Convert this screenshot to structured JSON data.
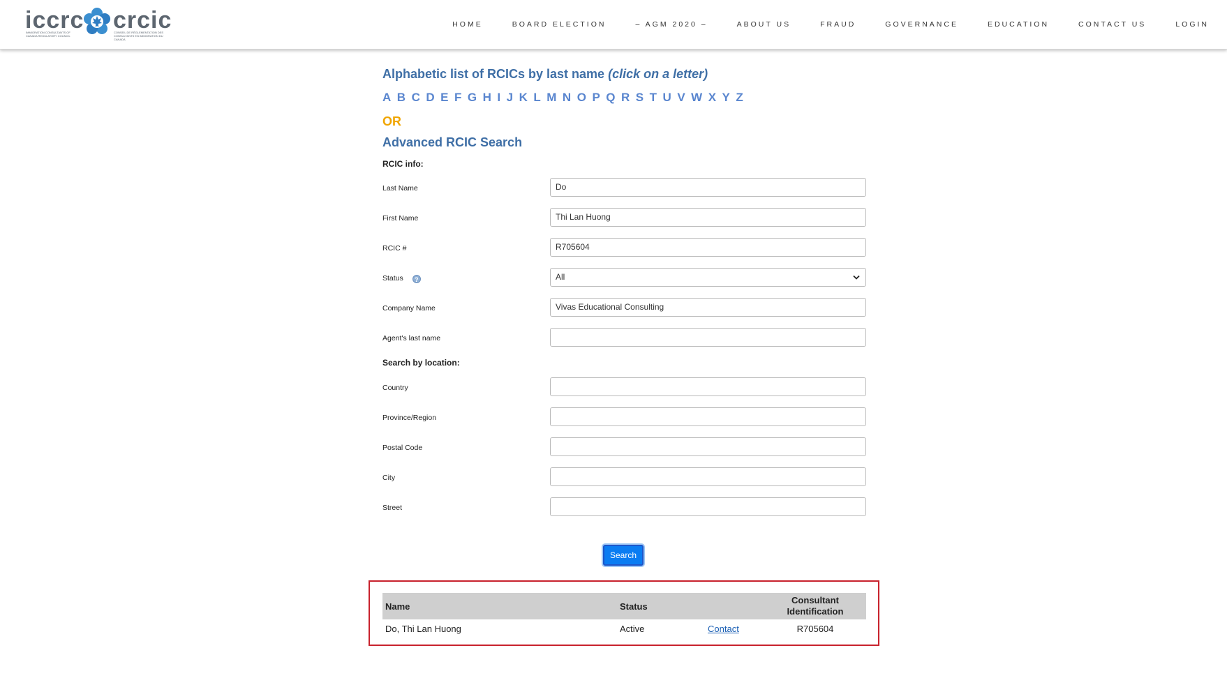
{
  "header": {
    "logo_left": "iccrc",
    "logo_right": "crcic",
    "logo_sub_left": "IMMIGRATION CONSULTANTS OF CANADA REGULATORY COUNCIL",
    "logo_sub_right": "CONSEIL DE RÉGLEMENTATION DES CONSULTANTS EN IMMIGRATION DU CANADA",
    "nav": [
      "HOME",
      "BOARD ELECTION",
      "– AGM 2020 –",
      "ABOUT US",
      "FRAUD",
      "GOVERNANCE",
      "EDUCATION",
      "CONTACT US",
      "LOGIN"
    ]
  },
  "alpha": {
    "title": "Alphabetic list of RCICs by last name",
    "title_hint": "(click on a letter)",
    "letters": [
      "A",
      "B",
      "C",
      "D",
      "E",
      "F",
      "G",
      "H",
      "I",
      "J",
      "K",
      "L",
      "M",
      "N",
      "O",
      "P",
      "Q",
      "R",
      "S",
      "T",
      "U",
      "V",
      "W",
      "X",
      "Y",
      "Z"
    ],
    "or": "OR"
  },
  "search": {
    "title": "Advanced RCIC Search",
    "info_label": "RCIC info:",
    "last_name": {
      "label": "Last Name",
      "value": "Do"
    },
    "first_name": {
      "label": "First Name",
      "value": "Thi Lan Huong"
    },
    "rcic_number": {
      "label": "RCIC #",
      "value": "R705604"
    },
    "status": {
      "label": "Status",
      "value": "All"
    },
    "company_name": {
      "label": "Company Name",
      "value": "Vivas Educational Consulting"
    },
    "agent_last_name": {
      "label": "Agent's last name",
      "value": ""
    },
    "location_label": "Search by location:",
    "country": {
      "label": "Country",
      "value": ""
    },
    "province": {
      "label": "Province/Region",
      "value": ""
    },
    "postal_code": {
      "label": "Postal Code",
      "value": ""
    },
    "city": {
      "label": "City",
      "value": ""
    },
    "street": {
      "label": "Street",
      "value": ""
    },
    "button": "Search"
  },
  "results": {
    "headers": {
      "name": "Name",
      "status": "Status",
      "consultant_id_line1": "Consultant",
      "consultant_id_line2": "Identification"
    },
    "rows": [
      {
        "name": "Do, Thi Lan Huong",
        "status": "Active",
        "contact": "Contact",
        "id": "R705604"
      }
    ]
  },
  "colors": {
    "accent_blue": "#3f6fa6",
    "letter_blue": "#5a86cf",
    "or_orange": "#f0a500",
    "button_blue": "#0a7cf2",
    "highlight_red": "#c8222d"
  }
}
